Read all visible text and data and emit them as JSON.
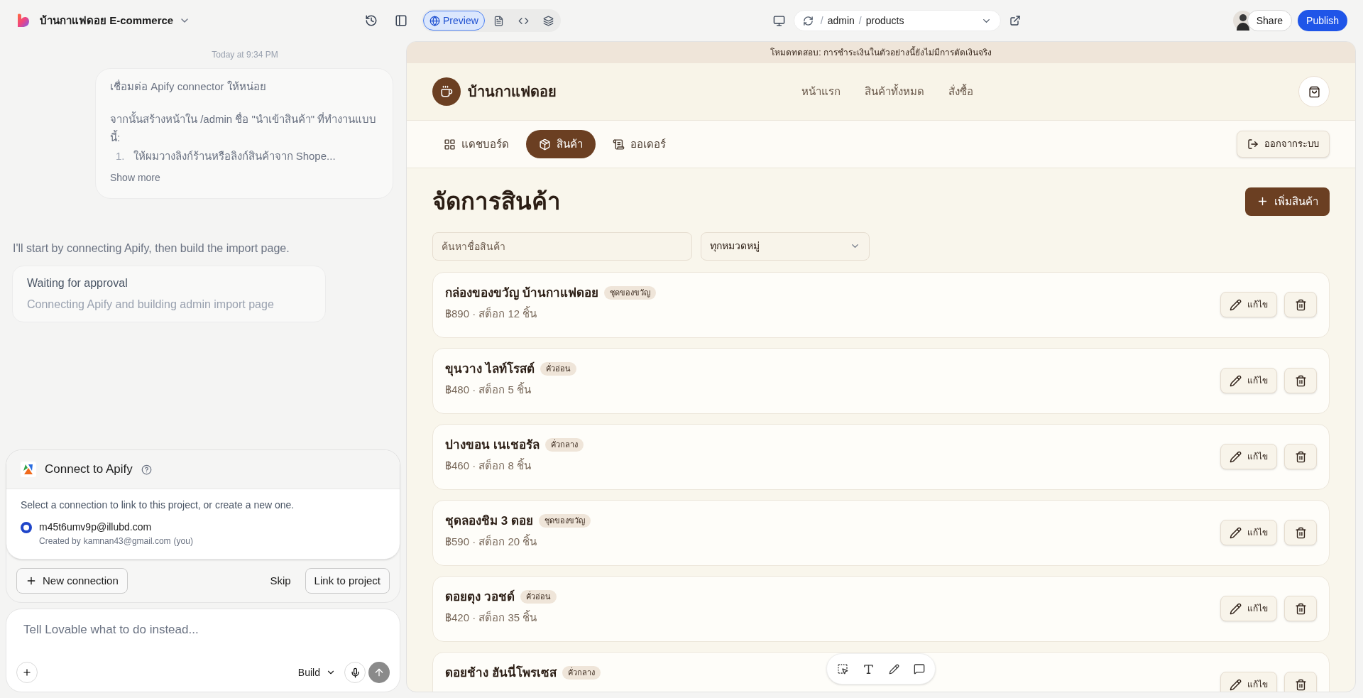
{
  "topbar": {
    "project_name": "บ้านกาแฟดอย E-commerce",
    "views": [
      {
        "kind": "preview",
        "label": "Preview",
        "selected": true
      },
      {
        "kind": "file",
        "selected": false
      },
      {
        "kind": "code",
        "selected": false
      },
      {
        "kind": "layers",
        "selected": false
      }
    ],
    "path": [
      {
        "kind": "separator",
        "text": "/"
      },
      {
        "kind": "segment",
        "text": "admin"
      },
      {
        "kind": "separator",
        "text": "/"
      },
      {
        "kind": "segment",
        "text": "products"
      }
    ],
    "share": "Share",
    "publish": "Publish"
  },
  "chat": {
    "timestamp": "Today at 9:34 PM",
    "user_message": {
      "lines": [
        "เชื่อมต่อ Apify connector ให้หน่อย",
        "จากนั้นสร้างหน้าใน /admin ชื่อ \"นำเข้าสินค้า\" ที่ทำงานแบบนี้:"
      ],
      "list_items": [
        {
          "marker": "1.",
          "text": "ให้ผมวางลิงก์ร้านหรือลิงก์สินค้าจาก Shope..."
        }
      ],
      "show_more": "Show more"
    },
    "assistant_message": "I'll start by connecting Apify, then build the import page.",
    "status_card": {
      "title": "Waiting for approval",
      "subtitle": "Connecting Apify and building admin import page"
    },
    "connect_card": {
      "title": "Connect to Apify",
      "description": "Select a connection to link to this project, or create a new one.",
      "connections": [
        {
          "email": "m45t6umv9p@illubd.com",
          "created_by": "Created by",
          "creator": "kamnan43@gmail.com",
          "suffix": "(you)",
          "selected": true
        }
      ],
      "new_connection": "New connection",
      "skip": "Skip",
      "link": "Link to project"
    },
    "composer": {
      "placeholder": "Tell Lovable what to do instead...",
      "mode": "Build"
    }
  },
  "preview": {
    "banner": "โหมดทดสอบ: การชำระเงินในตัวอย่างนี้ยังไม่มีการตัดเงินจริง",
    "store_name": "บ้านกาแฟดอย",
    "nav": [
      "หน้าแรก",
      "สินค้าทั้งหมด",
      "สั่งซื้อ"
    ],
    "admin_tabs": [
      {
        "kind": "dashboard",
        "label": "แดชบอร์ด",
        "selected": false
      },
      {
        "kind": "products",
        "label": "สินค้า",
        "selected": true
      },
      {
        "kind": "orders",
        "label": "ออเดอร์",
        "selected": false
      }
    ],
    "logout": "ออกจากระบบ",
    "title": "จัดการสินค้า",
    "add_button": "เพิ่มสินค้า",
    "search": {
      "placeholder": "ค้นหาชื่อสินค้า"
    },
    "category_select": "ทุกหมวดหมู่",
    "products": [
      {
        "name": "กล่องของขวัญ บ้านกาแฟดอย",
        "tag": "ชุดของขวัญ",
        "details": "฿890 · สต็อก 12 ชิ้น",
        "edit": "แก้ไข"
      },
      {
        "name": "ขุนวาง ไลท์โรสต์",
        "tag": "คั่วอ่อน",
        "details": "฿480 · สต็อก 5 ชิ้น",
        "edit": "แก้ไข"
      },
      {
        "name": "ปางขอน เนเชอรัล",
        "tag": "คั่วกลาง",
        "details": "฿460 · สต็อก 8 ชิ้น",
        "edit": "แก้ไข"
      },
      {
        "name": "ชุดลองชิม 3 ดอย",
        "tag": "ชุดของขวัญ",
        "details": "฿590 · สต็อก 20 ชิ้น",
        "edit": "แก้ไข"
      },
      {
        "name": "ดอยตุง วอชด์",
        "tag": "คั่วอ่อน",
        "details": "฿420 · สต็อก 35 ชิ้น",
        "edit": "แก้ไข"
      },
      {
        "name": "ดอยช้าง ฮันนี่โพรเซส",
        "tag": "คั่วกลาง",
        "edit": "แก้ไข"
      }
    ]
  }
}
